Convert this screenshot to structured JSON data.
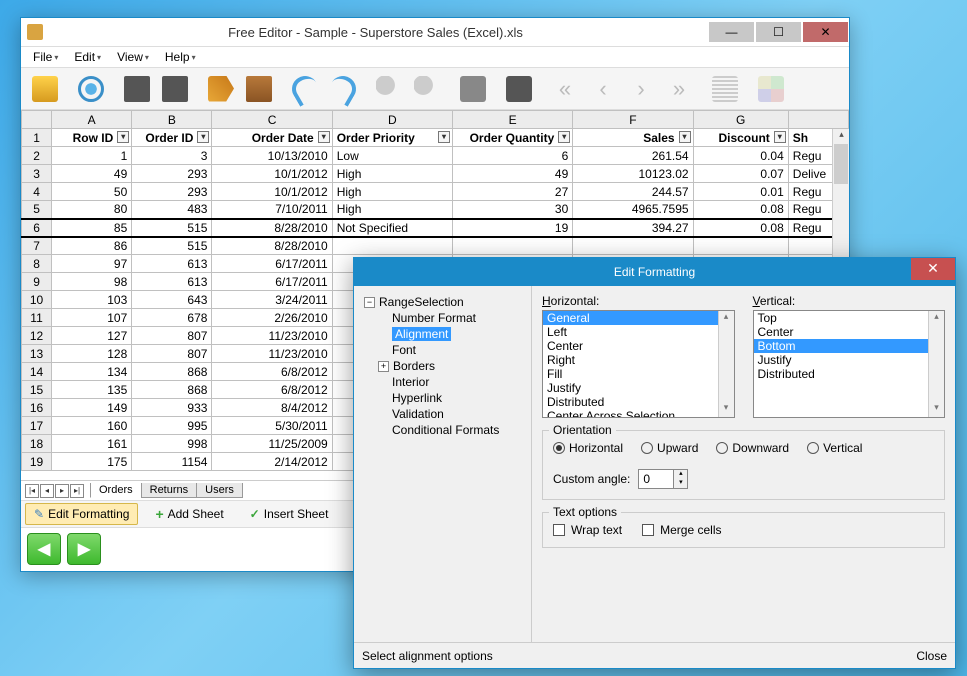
{
  "window": {
    "title": "Free Editor - Sample - Superstore Sales (Excel).xls"
  },
  "menu": {
    "file": "File",
    "edit": "Edit",
    "view": "View",
    "help": "Help"
  },
  "columns": [
    "",
    "A",
    "B",
    "C",
    "D",
    "E",
    "F",
    "G",
    ""
  ],
  "headers": [
    "Row ID",
    "Order ID",
    "Order Date",
    "Order Priority",
    "Order Quantity",
    "Sales",
    "Discount",
    "Sh"
  ],
  "rows": [
    {
      "n": "2",
      "c": [
        "1",
        "3",
        "10/13/2010",
        "Low",
        "6",
        "261.54",
        "0.04",
        "Regu"
      ]
    },
    {
      "n": "3",
      "c": [
        "49",
        "293",
        "10/1/2012",
        "High",
        "49",
        "10123.02",
        "0.07",
        "Delive"
      ]
    },
    {
      "n": "4",
      "c": [
        "50",
        "293",
        "10/1/2012",
        "High",
        "27",
        "244.57",
        "0.01",
        "Regu"
      ]
    },
    {
      "n": "5",
      "c": [
        "80",
        "483",
        "7/10/2011",
        "High",
        "30",
        "4965.7595",
        "0.08",
        "Regu"
      ]
    },
    {
      "n": "6",
      "c": [
        "85",
        "515",
        "8/28/2010",
        "Not Specified",
        "19",
        "394.27",
        "0.08",
        "Regu"
      ]
    },
    {
      "n": "7",
      "c": [
        "86",
        "515",
        "8/28/2010",
        "",
        "",
        "",
        "",
        ""
      ]
    },
    {
      "n": "8",
      "c": [
        "97",
        "613",
        "6/17/2011",
        "",
        "",
        "",
        "",
        ""
      ]
    },
    {
      "n": "9",
      "c": [
        "98",
        "613",
        "6/17/2011",
        "",
        "",
        "",
        "",
        ""
      ]
    },
    {
      "n": "10",
      "c": [
        "103",
        "643",
        "3/24/2011",
        "",
        "",
        "",
        "",
        ""
      ]
    },
    {
      "n": "11",
      "c": [
        "107",
        "678",
        "2/26/2010",
        "",
        "",
        "",
        "",
        ""
      ]
    },
    {
      "n": "12",
      "c": [
        "127",
        "807",
        "11/23/2010",
        "",
        "",
        "",
        "",
        ""
      ]
    },
    {
      "n": "13",
      "c": [
        "128",
        "807",
        "11/23/2010",
        "",
        "",
        "",
        "",
        ""
      ]
    },
    {
      "n": "14",
      "c": [
        "134",
        "868",
        "6/8/2012",
        "",
        "",
        "",
        "",
        ""
      ]
    },
    {
      "n": "15",
      "c": [
        "135",
        "868",
        "6/8/2012",
        "",
        "",
        "",
        "",
        ""
      ]
    },
    {
      "n": "16",
      "c": [
        "149",
        "933",
        "8/4/2012",
        "",
        "",
        "",
        "",
        ""
      ]
    },
    {
      "n": "17",
      "c": [
        "160",
        "995",
        "5/30/2011",
        "",
        "",
        "",
        "",
        ""
      ]
    },
    {
      "n": "18",
      "c": [
        "161",
        "998",
        "11/25/2009",
        "",
        "",
        "",
        "",
        ""
      ]
    },
    {
      "n": "19",
      "c": [
        "175",
        "1154",
        "2/14/2012",
        "",
        "",
        "",
        "",
        ""
      ]
    }
  ],
  "sheets": {
    "s1": "Orders",
    "s2": "Returns",
    "s3": "Users"
  },
  "actions": {
    "edit_formatting": "Edit Formatting",
    "add_sheet": "Add Sheet",
    "insert_sheet": "Insert Sheet"
  },
  "dialog": {
    "title": "Edit Formatting",
    "tree": {
      "root": "RangeSelection",
      "n1": "Number Format",
      "n2": "Alignment",
      "n3": "Font",
      "n4": "Borders",
      "n5": "Interior",
      "n6": "Hyperlink",
      "n7": "Validation",
      "n8": "Conditional Formats"
    },
    "horiz": {
      "label": "Horizontal:",
      "o1": "General",
      "o2": "Left",
      "o3": "Center",
      "o4": "Right",
      "o5": "Fill",
      "o6": "Justify",
      "o7": "Distributed",
      "o8": "Center Across Selection"
    },
    "vert": {
      "label": "Vertical:",
      "o1": "Top",
      "o2": "Center",
      "o3": "Bottom",
      "o4": "Justify",
      "o5": "Distributed"
    },
    "orient": {
      "legend": "Orientation",
      "r1": "Horizontal",
      "r2": "Upward",
      "r3": "Downward",
      "r4": "Vertical",
      "angle_lbl": "Custom angle:",
      "angle_val": "0"
    },
    "textopt": {
      "legend": "Text options",
      "wrap": "Wrap text",
      "merge": "Merge cells"
    },
    "status": "Select alignment options",
    "close": "Close"
  }
}
